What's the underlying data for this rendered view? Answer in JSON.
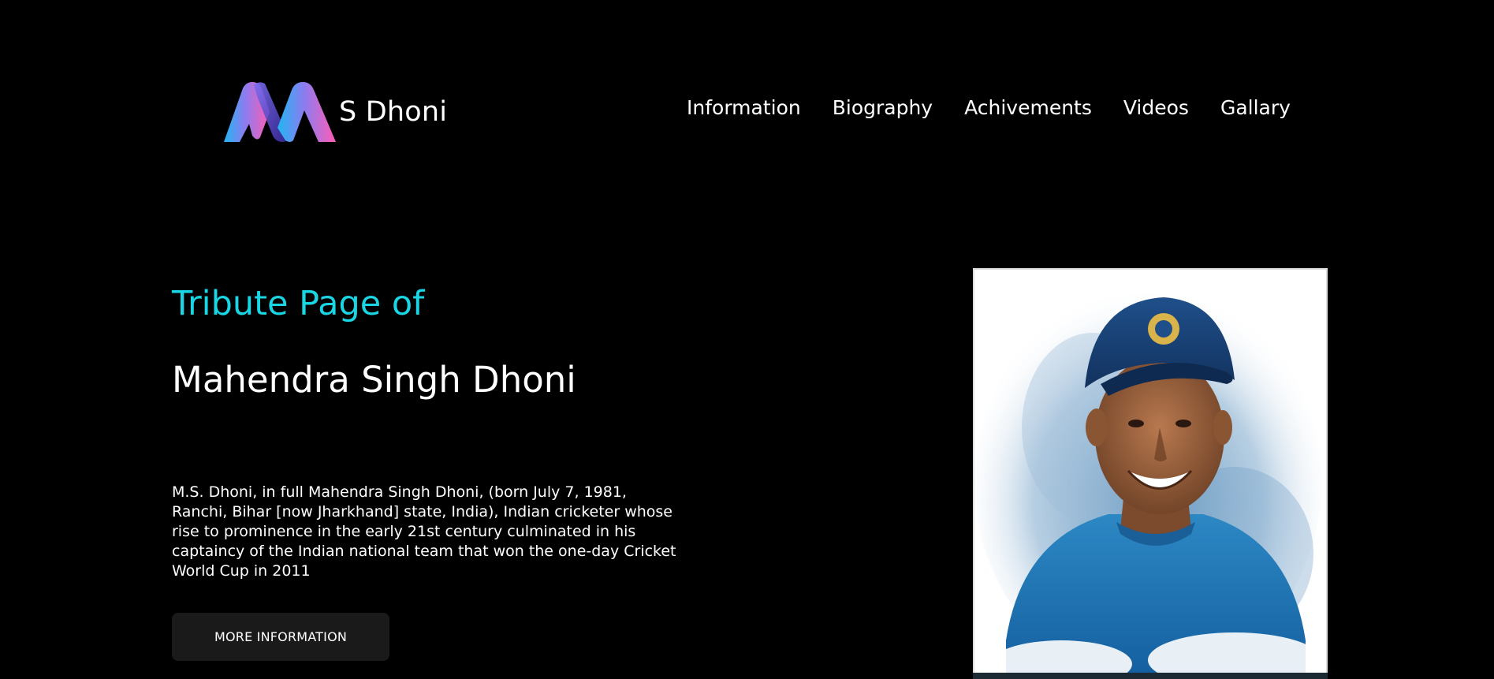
{
  "header": {
    "logo_text": "S Dhoni",
    "nav": [
      {
        "label": "Information"
      },
      {
        "label": "Biography"
      },
      {
        "label": "Achivements"
      },
      {
        "label": "Videos"
      },
      {
        "label": "Gallary"
      }
    ]
  },
  "hero": {
    "tribute_title": "Tribute Page of",
    "name": "Mahendra Singh Dhoni",
    "description": "M.S. Dhoni, in full Mahendra Singh Dhoni, (born July 7, 1981, Ranchi, Bihar [now Jharkhand] state, India), Indian cricketer whose rise to prominence in the early 21st century culminated in his captaincy of the Indian national team that won the one-day Cricket World Cup in 2011",
    "button_label": "MORE INFORMATION"
  },
  "colors": {
    "background": "#000000",
    "accent": "#1ad5e3",
    "button_bg": "#1a1a1a",
    "logo_gradient_start": "#2ab4f5",
    "logo_gradient_end": "#ff5fb8"
  },
  "icons": {
    "logo": "m-ribbon-logo-icon",
    "portrait": "dhoni-portrait-illustration"
  }
}
